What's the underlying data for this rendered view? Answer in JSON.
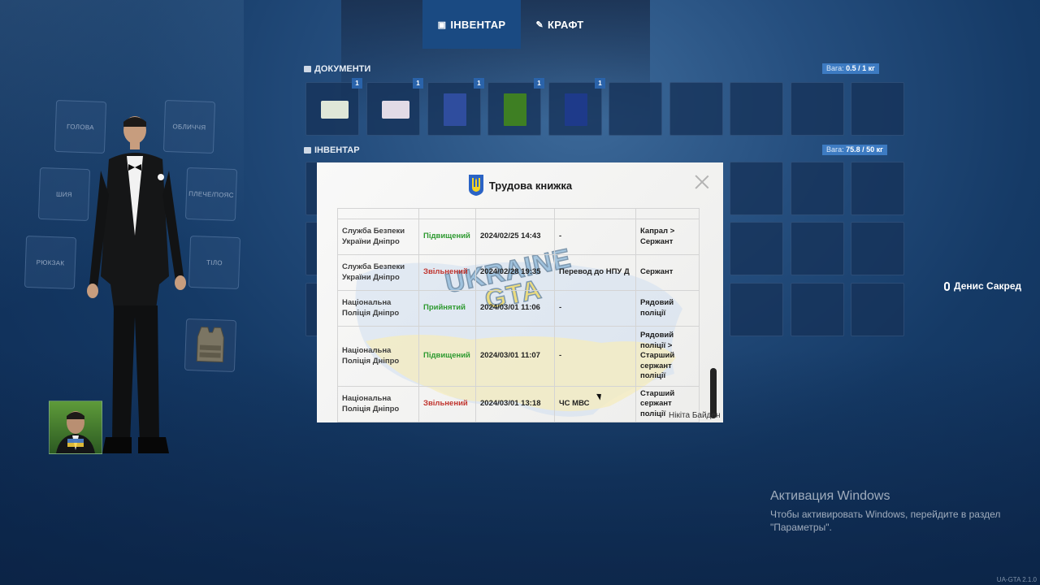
{
  "tabs": [
    {
      "label": "ІНВЕНТАР",
      "active": true
    },
    {
      "label": "КРАФТ",
      "active": false
    }
  ],
  "documents": {
    "title": "ДОКУМЕНТИ",
    "weight_label": "Вага:",
    "weight_value": "0.5 / 1 кг",
    "items": [
      {
        "count": "1",
        "color": "#dfe7d8"
      },
      {
        "count": "1",
        "color": "#e2dbe6"
      },
      {
        "count": "1",
        "color": "#2f4d9e"
      },
      {
        "count": "1",
        "color": "#3e7f23"
      },
      {
        "count": "1",
        "color": "#1e3a8a"
      }
    ]
  },
  "inventory": {
    "title": "ІНВЕНТАР",
    "weight_label": "Вага:",
    "weight_value": "75.8 / 50 кг"
  },
  "equipment": {
    "head": "ГОЛОВА",
    "face": "ОБЛИЧЧЯ",
    "neck": "ШИЯ",
    "shoulder": "ПЛЕЧЕ/ПОЯС",
    "backpack": "РЮКЗАК",
    "body": "ТІЛО"
  },
  "modal": {
    "title": "Трудова книжка",
    "rows": [
      {
        "org": "Служба Безпеки України Дніпро",
        "action": "Підвищений",
        "action_type": "up",
        "date": "2024/02/25 14:43",
        "reason": "-",
        "rank": "Капрал > Сержант"
      },
      {
        "org": "Служба Безпеки України Дніпро",
        "action": "Звільнений",
        "action_type": "down",
        "date": "2024/02/28 19:35",
        "reason": "Перевод до НПУ Д",
        "rank": "Сержант"
      },
      {
        "org": "Національна Поліція Дніпро",
        "action": "Прийнятий",
        "action_type": "up",
        "date": "2024/03/01 11:06",
        "reason": "-",
        "rank": "Рядовий поліції"
      },
      {
        "org": "Національна Поліція Дніпро",
        "action": "Підвищений",
        "action_type": "up",
        "date": "2024/03/01 11:07",
        "reason": "-",
        "rank": "Рядовий поліції > Старший сержант поліції"
      },
      {
        "org": "Національна Поліція Дніпро",
        "action": "Звільнений",
        "action_type": "down",
        "date": "2024/03/01 13:18",
        "reason": "ЧС МВС",
        "rank": "Старший сержант поліції"
      }
    ],
    "signature": "Нікіта Байден",
    "watermark_top": "UKRAINE",
    "watermark_bottom": "GTA"
  },
  "voice": {
    "name": "Денис Сакред"
  },
  "windows": {
    "title": "Активация Windows",
    "line1": "Чтобы активировать Windows, перейдите в раздел",
    "line2": "\"Параметры\"."
  },
  "version": "UA-GTA 2.1.0"
}
